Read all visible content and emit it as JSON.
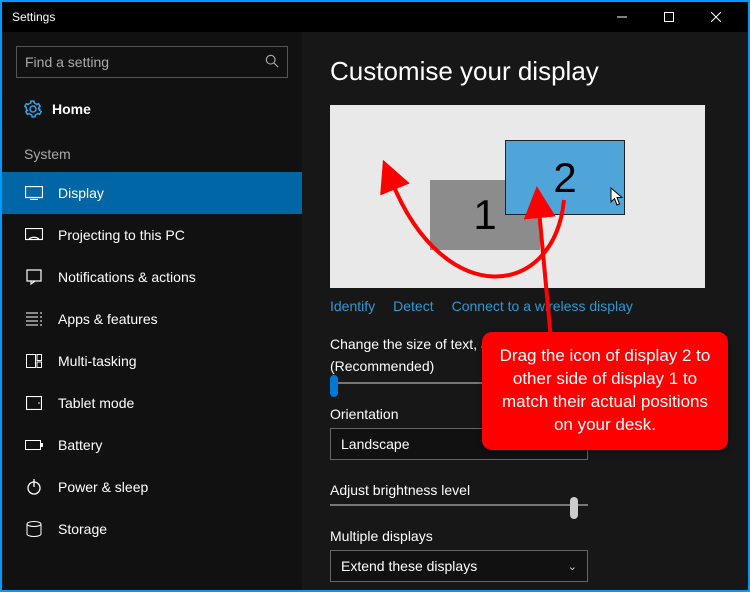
{
  "window": {
    "title": "Settings"
  },
  "sidebar": {
    "search_placeholder": "Find a setting",
    "home": "Home",
    "category": "System",
    "items": [
      {
        "icon": "display-icon",
        "label": "Display",
        "active": true
      },
      {
        "icon": "project-icon",
        "label": "Projecting to this PC"
      },
      {
        "icon": "notifications-icon",
        "label": "Notifications & actions"
      },
      {
        "icon": "apps-icon",
        "label": "Apps & features"
      },
      {
        "icon": "multitask-icon",
        "label": "Multi-tasking"
      },
      {
        "icon": "tablet-icon",
        "label": "Tablet mode"
      },
      {
        "icon": "battery-icon",
        "label": "Battery"
      },
      {
        "icon": "power-icon",
        "label": "Power & sleep"
      },
      {
        "icon": "storage-icon",
        "label": "Storage"
      }
    ]
  },
  "main": {
    "heading": "Customise your display",
    "display1_label": "1",
    "display2_label": "2",
    "links": {
      "identify": "Identify",
      "detect": "Detect",
      "wireless": "Connect to a wireless display"
    },
    "scale_label": "Change the size of text, apps and other items: 100%",
    "scale_rec": "(Recommended)",
    "orientation_label": "Orientation",
    "orientation_value": "Landscape",
    "brightness_label": "Adjust brightness level",
    "multiple_label": "Multiple displays",
    "multiple_value": "Extend these displays"
  },
  "annotation": {
    "text": "Drag the icon of display 2 to other side of display 1 to match their actual positions on your desk."
  }
}
